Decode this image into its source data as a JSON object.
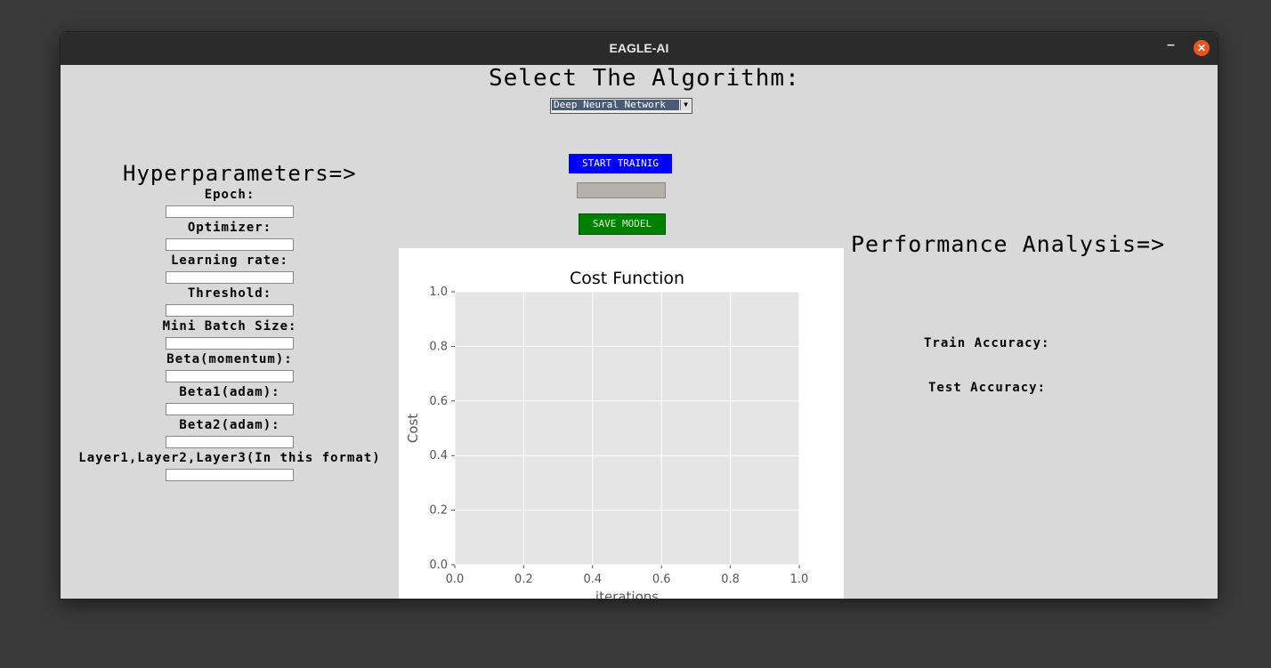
{
  "window": {
    "title": "EAGLE-AI",
    "minimize_glyph": "–",
    "close_glyph": "✕"
  },
  "algorithm": {
    "heading": "Select The Algorithm:",
    "selected": "Deep Neural Network",
    "start_label": "START TRAINIG",
    "save_label": "SAVE MODEL",
    "progress": 0
  },
  "hyperparameters": {
    "heading": "Hyperparameters=>",
    "fields": [
      {
        "label": "Epoch:",
        "value": ""
      },
      {
        "label": "Optimizer:",
        "value": ""
      },
      {
        "label": "Learning rate:",
        "value": ""
      },
      {
        "label": "Threshold:",
        "value": ""
      },
      {
        "label": "Mini Batch Size:",
        "value": ""
      },
      {
        "label": "Beta(momentum):",
        "value": ""
      },
      {
        "label": "Beta1(adam):",
        "value": ""
      },
      {
        "label": "Beta2(adam):",
        "value": ""
      },
      {
        "label": "Layer1,Layer2,Layer3(In this format)",
        "value": ""
      }
    ]
  },
  "performance": {
    "heading": "Performance Analysis=>",
    "train_label": "Train Accuracy:",
    "test_label": "Test Accuracy:"
  },
  "colors": {
    "start_button": "#0000ff",
    "save_button": "#008000",
    "plot_bg": "#e5e5e5"
  },
  "chart_data": {
    "type": "line",
    "title": "Cost Function",
    "xlabel": "iterations",
    "ylabel": "Cost",
    "xlim": [
      0.0,
      1.0
    ],
    "ylim": [
      0.0,
      1.0
    ],
    "xticks": [
      "0.0",
      "0.2",
      "0.4",
      "0.6",
      "0.8",
      "1.0"
    ],
    "yticks": [
      "0.0",
      "0.2",
      "0.4",
      "0.6",
      "0.8",
      "1.0"
    ],
    "grid": true,
    "series": []
  }
}
